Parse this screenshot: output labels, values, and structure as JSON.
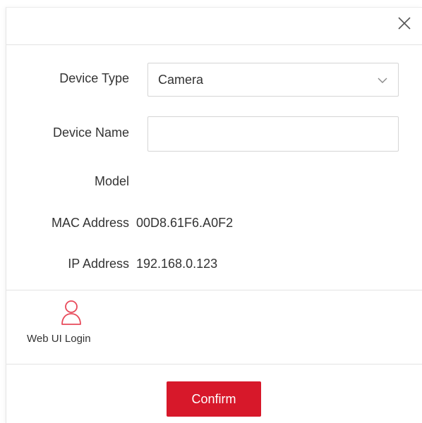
{
  "dialog": {
    "close_icon": "close-icon",
    "fields": {
      "device_type": {
        "label": "Device Type",
        "value": "Camera",
        "caret_icon": "chevron-down-icon"
      },
      "device_name": {
        "label": "Device Name",
        "value": "",
        "placeholder": ""
      },
      "model": {
        "label": "Model",
        "value": ""
      },
      "mac_address": {
        "label": "MAC Address",
        "value": "00D8.61F6.A0F2"
      },
      "ip_address": {
        "label": "IP Address",
        "value": "192.168.0.123"
      }
    },
    "actions": {
      "web_ui_login": {
        "label": "Web UI Login",
        "icon": "user-icon"
      },
      "confirm_label": "Confirm"
    }
  },
  "colors": {
    "accent": "#d7182a",
    "icon_accent": "#e8495a",
    "text": "#333333",
    "border": "#d5d5d5",
    "divider": "#e3e3e3"
  }
}
